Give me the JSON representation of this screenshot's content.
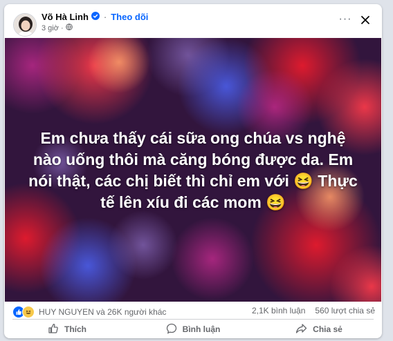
{
  "post": {
    "author": "Võ Hà Linh",
    "separator": "·",
    "follow_label": "Theo dõi",
    "time": "3 giờ",
    "time_separator": "·",
    "more_label": "···"
  },
  "media": {
    "text": "Em chưa thấy cái sữa ong chúa vs nghệ nào uống thôi mà căng bóng được da. Em nói thật, các chị biết thì chỉ em với 😆 Thực tế lên xíu đi các mom 😆"
  },
  "stats": {
    "reactions_text": "HUY NGUYEN và 26K người khác",
    "comments": "2,1K bình luận",
    "shares": "560 lượt chia sẻ"
  },
  "actions": {
    "like": "Thích",
    "comment": "Bình luận",
    "share": "Chia sẻ"
  },
  "colors": {
    "accent": "#0866ff",
    "verified": "#0866ff",
    "muted": "#65676b",
    "background": "#dfe3ea"
  },
  "icons": [
    "verified-badge-icon",
    "globe-icon",
    "more-icon",
    "close-icon",
    "like-reaction-icon",
    "haha-reaction-icon",
    "thumb-up-icon",
    "comment-icon",
    "share-icon"
  ]
}
